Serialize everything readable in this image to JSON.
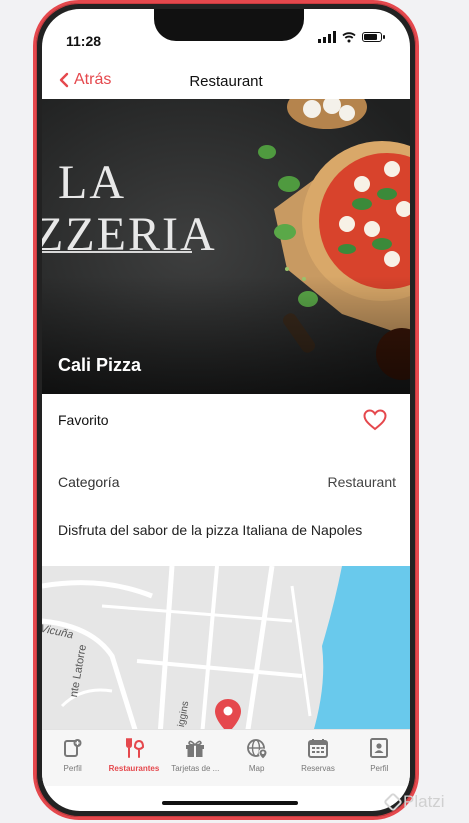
{
  "status": {
    "time": "11:28"
  },
  "nav": {
    "back_label": "Atrás",
    "title": "Restaurant"
  },
  "hero": {
    "logo_line1": "LA",
    "logo_line2": "ZZERIA",
    "restaurant_name": "Cali Pizza"
  },
  "favorite": {
    "label": "Favorito",
    "is_favorite": false
  },
  "category": {
    "label": "Categoría",
    "value": "Restaurant"
  },
  "description": "Disfruta del sabor de la pizza Italiana de Napoles",
  "map": {
    "street_labels": [
      "Vicuña",
      "nte Latorre",
      "iggins"
    ],
    "marker_icon": "map-pin-icon",
    "colors": {
      "land": "#e6e6e6",
      "water": "#69c9ec",
      "road": "#ffffff",
      "marker": "#e5484d"
    }
  },
  "tabs": [
    {
      "label": "Perfil",
      "icon": "profile-add-icon",
      "active": false
    },
    {
      "label": "Restaurantes",
      "icon": "fork-knife-icon",
      "active": true
    },
    {
      "label": "Tarjetas de ...",
      "icon": "gift-icon",
      "active": false
    },
    {
      "label": "Map",
      "icon": "globe-location-icon",
      "active": false
    },
    {
      "label": "Reservas",
      "icon": "calendar-icon",
      "active": false
    },
    {
      "label": "Perfil",
      "icon": "id-card-icon",
      "active": false
    }
  ],
  "accent_color": "#e5484d",
  "watermark": "Platzi"
}
